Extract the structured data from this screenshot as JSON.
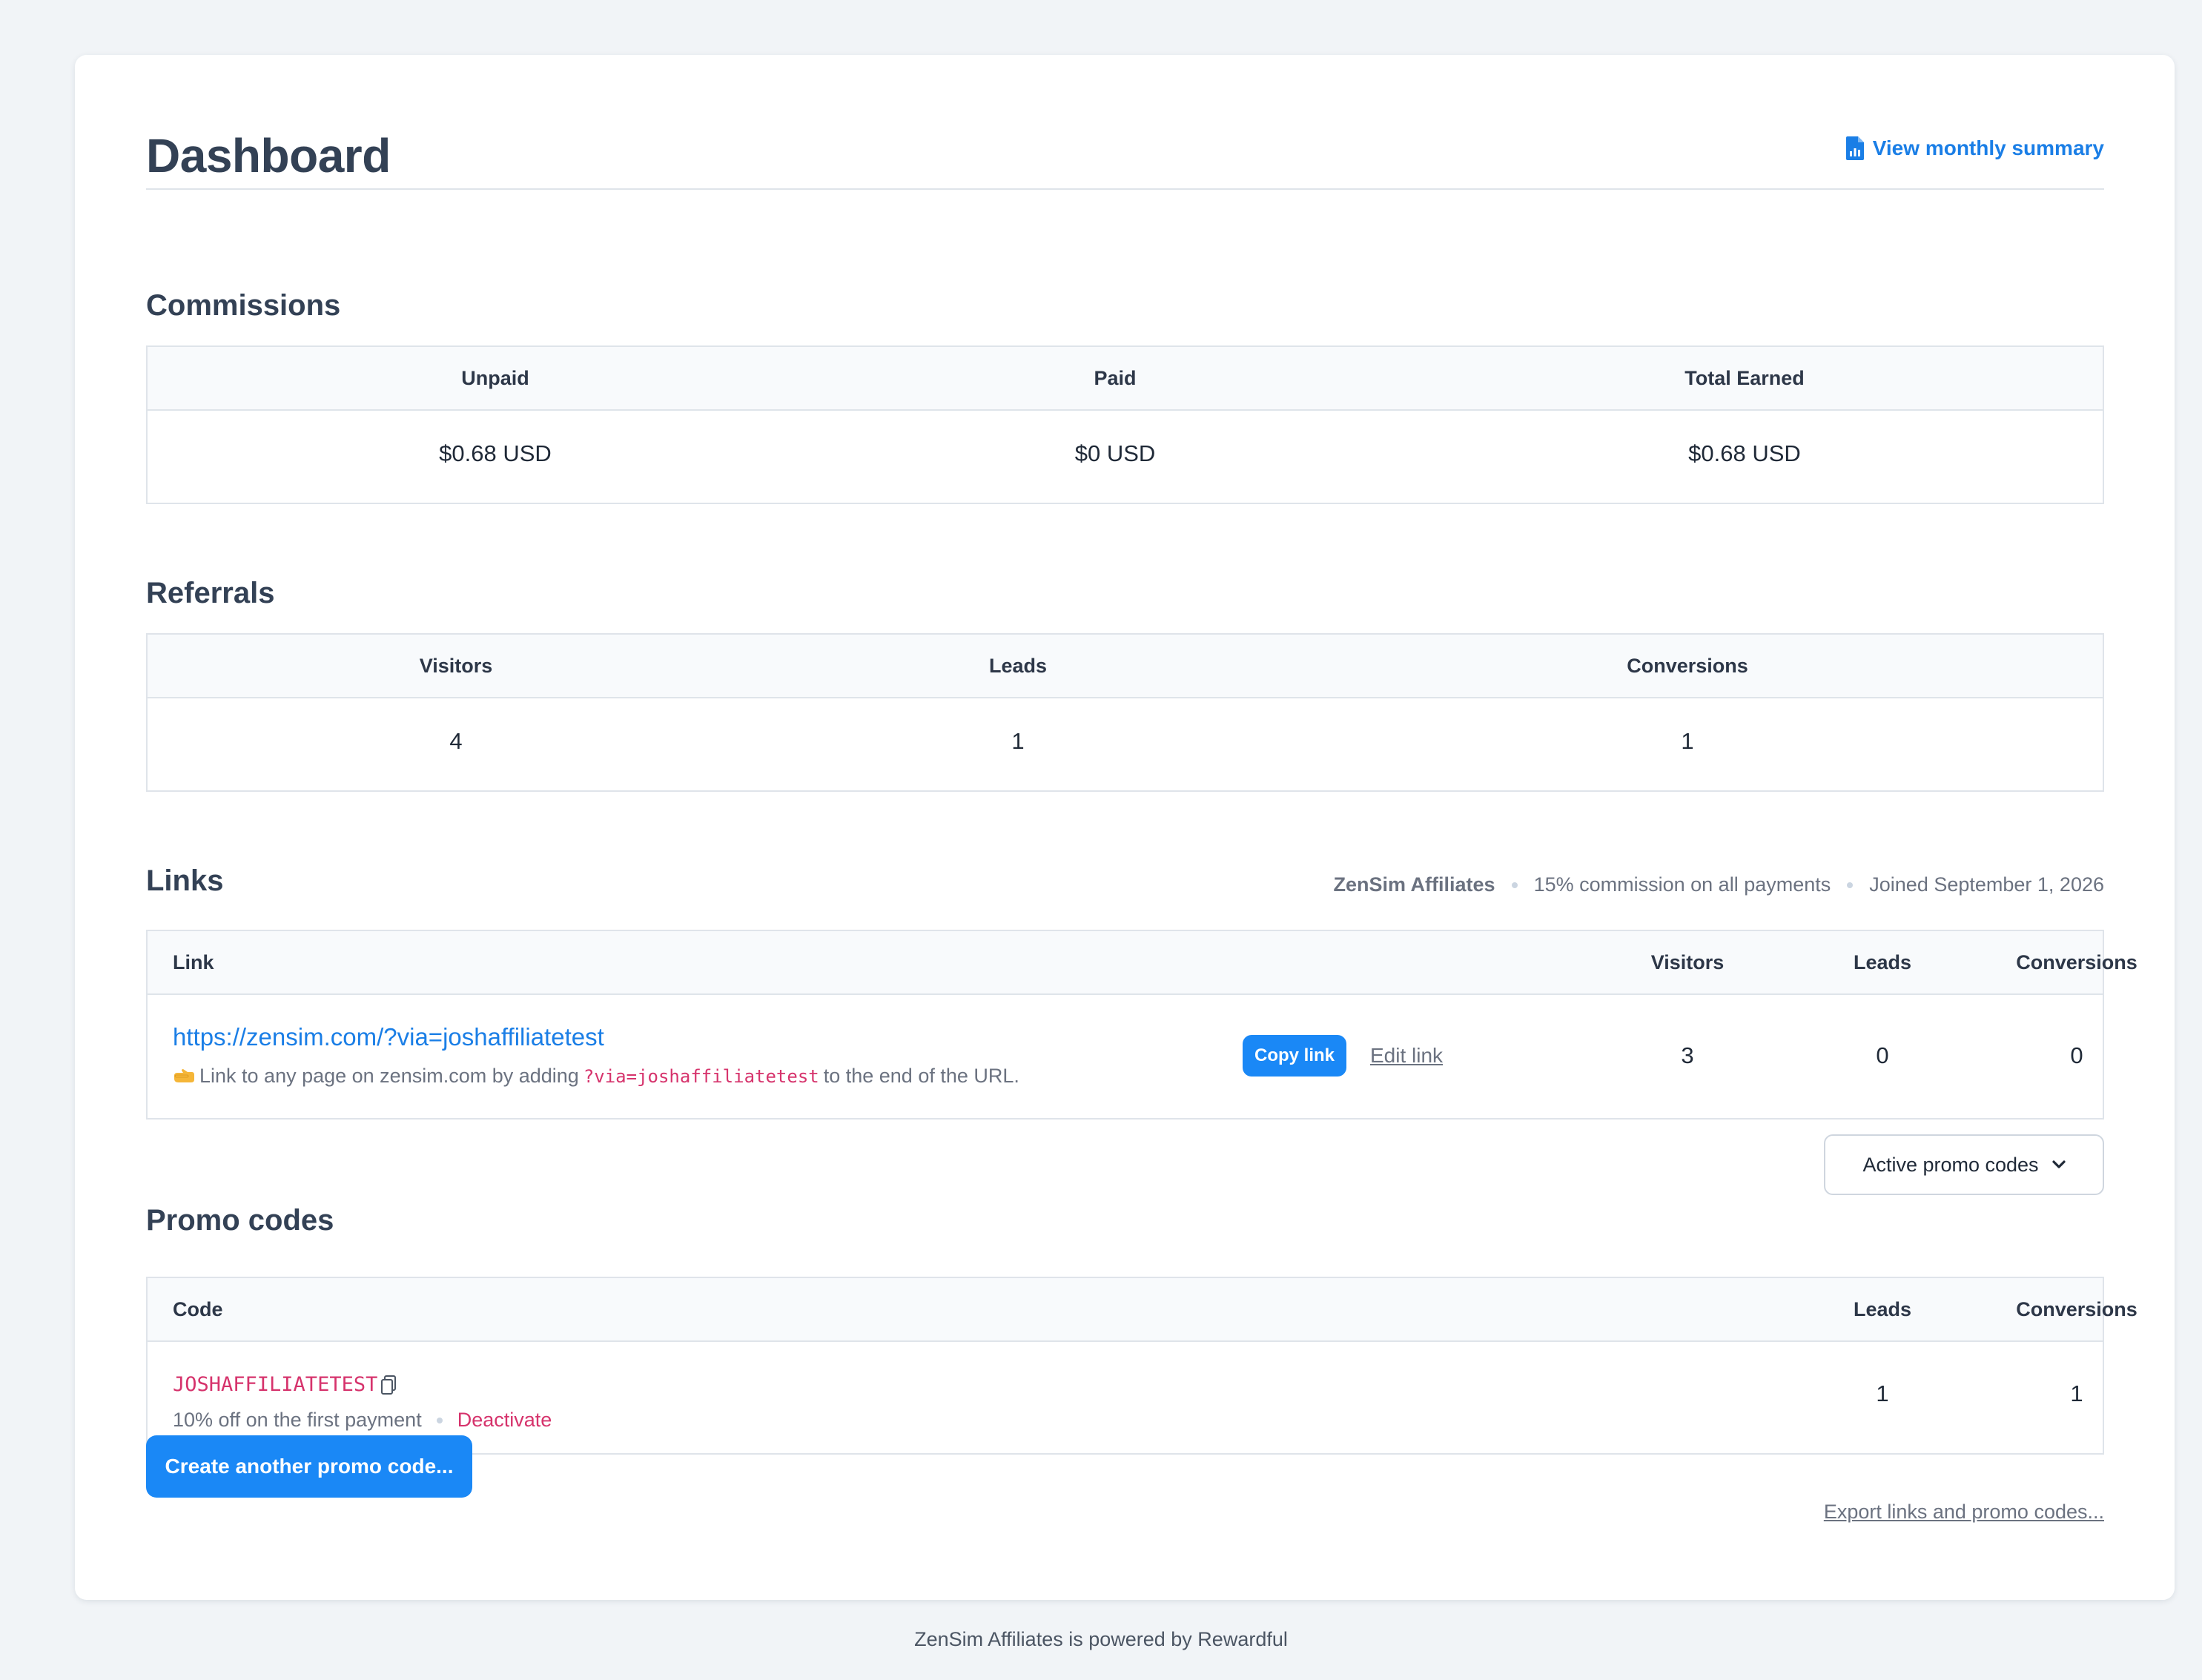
{
  "header": {
    "title": "Dashboard",
    "monthly_summary_label": "View monthly summary",
    "monthly_summary_icon": "report-icon"
  },
  "commissions": {
    "title": "Commissions",
    "headers": [
      "Unpaid",
      "Paid",
      "Total Earned"
    ],
    "values": [
      "$0.68 USD",
      "$0 USD",
      "$0.68 USD"
    ]
  },
  "referrals": {
    "title": "Referrals",
    "headers": [
      "Visitors",
      "Leads",
      "Conversions"
    ],
    "values": [
      "4",
      "1",
      "1"
    ]
  },
  "links": {
    "title": "Links",
    "meta": {
      "program": "ZenSim Affiliates",
      "commission": "15% commission on all payments",
      "joined": "Joined September 1, 2026"
    },
    "headers": {
      "link": "Link",
      "visitors": "Visitors",
      "leads": "Leads",
      "conversions": "Conversions"
    },
    "rows": [
      {
        "url": "https://zensim.com/?via=joshaffiliatetest",
        "hint_prefix": "Link to any page on zensim.com by adding",
        "hint_code": "?via=joshaffiliatetest",
        "hint_suffix": "to the end of the URL.",
        "copy_label": "Copy link",
        "edit_label": "Edit link",
        "visitors": "3",
        "leads": "0",
        "conversions": "0"
      }
    ]
  },
  "promo_codes": {
    "title": "Promo codes",
    "filter_selected": "Active promo codes",
    "headers": {
      "code": "Code",
      "leads": "Leads",
      "conversions": "Conversions"
    },
    "rows": [
      {
        "code": "JOSHAFFILIATETEST",
        "description": "10% off on the first payment",
        "action_label": "Deactivate",
        "leads": "1",
        "conversions": "1"
      }
    ],
    "create_label": "Create another promo code...",
    "export_label": "Export links and promo codes..."
  },
  "footer": {
    "text": "ZenSim Affiliates is powered by Rewardful"
  },
  "colors": {
    "accent": "#1a88f6",
    "link": "#1a7ee6",
    "code": "#d6336c",
    "background": "#f1f4f7"
  }
}
